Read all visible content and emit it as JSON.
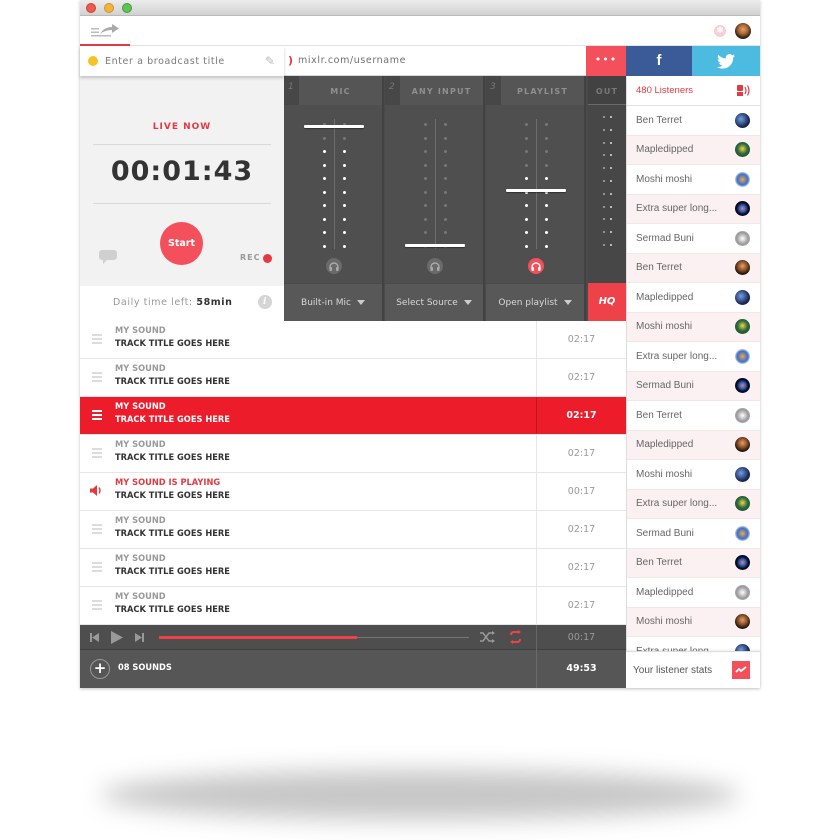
{
  "window": {
    "buttons": [
      "close",
      "minimize",
      "zoom"
    ]
  },
  "toolbar": {
    "menu_icon": "menu-share-icon",
    "close_icon": "close-icon"
  },
  "broadcast": {
    "title_placeholder": "Enter a broadcast title",
    "status_color": "#f7c324",
    "url": "mixlr.com/username"
  },
  "share": {
    "more_label": "•••",
    "facebook_label": "f"
  },
  "live": {
    "status": "LIVE NOW",
    "timer": "00:01:43",
    "start_label": "Start",
    "rec_label": "REC"
  },
  "daily": {
    "label": "Daily time left:",
    "value": "58min",
    "info_label": "i"
  },
  "mixer": {
    "channels": [
      {
        "num": "1",
        "name": "MIC",
        "source": "Built-in Mic",
        "level": 1.0,
        "active_leds": 8,
        "monitor": false
      },
      {
        "num": "2",
        "name": "ANY INPUT",
        "source": "Select Source",
        "level": 0.0,
        "active_leds": 0,
        "monitor": false
      },
      {
        "num": "3",
        "name": "PLAYLIST",
        "source": "Open playlist",
        "level": 0.45,
        "active_leds": 6,
        "monitor": true
      }
    ],
    "out_label": "OUT",
    "hq_label": "HQ"
  },
  "listeners": {
    "count_label": "480 Listeners",
    "items": [
      {
        "name": "Ben Terret"
      },
      {
        "name": "Mapledipped"
      },
      {
        "name": "Moshi moshi"
      },
      {
        "name": "Extra super long..."
      },
      {
        "name": "Sermad Buni"
      },
      {
        "name": "Ben Terret"
      },
      {
        "name": "Mapledipped"
      },
      {
        "name": "Moshi moshi"
      },
      {
        "name": "Extra super long..."
      },
      {
        "name": "Sermad Buni"
      },
      {
        "name": "Ben Terret"
      },
      {
        "name": "Mapledipped"
      },
      {
        "name": "Moshi moshi"
      },
      {
        "name": "Extra super long..."
      },
      {
        "name": "Sermad Buni"
      },
      {
        "name": "Ben Terret"
      },
      {
        "name": "Mapledipped"
      },
      {
        "name": "Moshi moshi"
      },
      {
        "name": "Extra super long..."
      }
    ],
    "stats_label": "Your listener stats"
  },
  "tracks": [
    {
      "artist": "MY SOUND",
      "title": "TRACK TITLE GOES HERE",
      "duration": "02:17",
      "state": "normal"
    },
    {
      "artist": "MY SOUND",
      "title": "TRACK TITLE GOES HERE",
      "duration": "02:17",
      "state": "normal"
    },
    {
      "artist": "MY SOUND",
      "title": "TRACK TITLE GOES HERE",
      "duration": "02:17",
      "state": "active"
    },
    {
      "artist": "MY SOUND",
      "title": "TRACK TITLE GOES HERE",
      "duration": "02:17",
      "state": "normal"
    },
    {
      "artist": "MY SOUND IS PLAYING",
      "title": "TRACK TITLE GOES HERE",
      "duration": "00:17",
      "state": "playing"
    },
    {
      "artist": "MY SOUND",
      "title": "TRACK TITLE GOES HERE",
      "duration": "02:17",
      "state": "normal"
    },
    {
      "artist": "MY SOUND",
      "title": "TRACK TITLE GOES HERE",
      "duration": "02:17",
      "state": "normal"
    },
    {
      "artist": "MY SOUND",
      "title": "TRACK TITLE GOES HERE",
      "duration": "02:17",
      "state": "normal"
    }
  ],
  "player": {
    "progress": 0.64,
    "current_time": "00:17",
    "shuffle": false,
    "repeat": true
  },
  "footer": {
    "add_label": "+",
    "sound_count": "08 SOUNDS",
    "total_time": "49:53"
  },
  "colors": {
    "accent": "#ef4149",
    "facebook": "#3a5a98",
    "twitter": "#4cbbe0",
    "dark": "#4f4f4f"
  }
}
